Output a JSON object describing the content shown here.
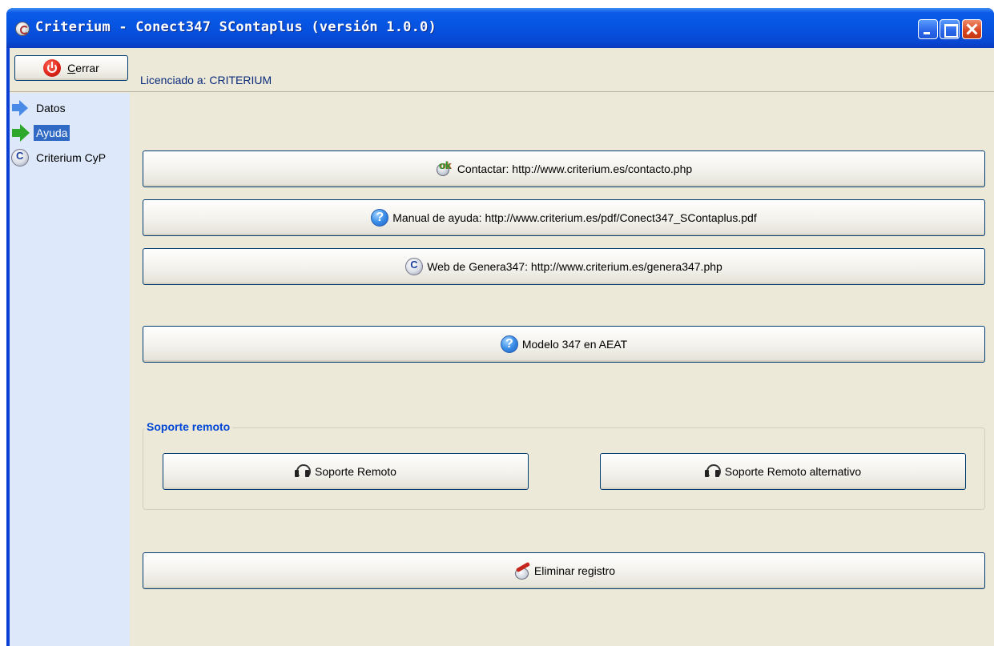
{
  "window": {
    "title": "Criterium - Conect347 SContaplus (versión 1.0.0)"
  },
  "toolbar": {
    "close_label_prefix": "",
    "close_accel": "C",
    "close_label_rest": "errar",
    "license_text": "Licenciado a: CRITERIUM"
  },
  "sidebar": {
    "items": [
      {
        "label": "Datos",
        "icon": "blue-arrow-icon",
        "selected": false
      },
      {
        "label": "Ayuda",
        "icon": "green-arrow-icon",
        "selected": true
      },
      {
        "label": "Criterium CyP",
        "icon": "criterium-cyp-icon",
        "selected": false
      }
    ]
  },
  "main": {
    "contact_label": "Contactar: http://www.criterium.es/contacto.php",
    "manual_label": "Manual de ayuda: http://www.criterium.es/pdf/Conect347_SContaplus.pdf",
    "web_label": "Web de Genera347: http://www.criterium.es/genera347.php",
    "aeat_label": "Modelo 347 en AEAT",
    "remote_group_title": "Soporte remoto",
    "remote_label": "Soporte Remoto",
    "remote_alt_label": "Soporte Remoto alternativo",
    "delete_label": "Eliminar registro"
  }
}
